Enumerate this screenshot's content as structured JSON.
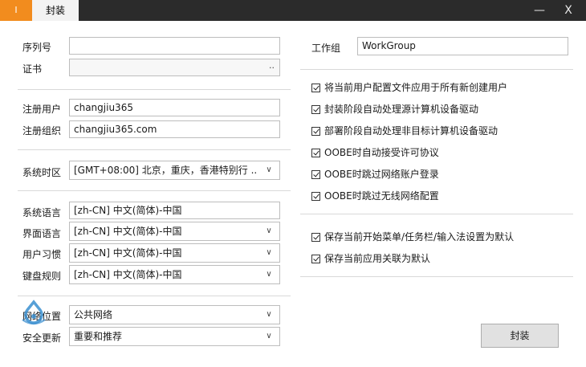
{
  "window": {
    "app_badge": "I",
    "tab_title": "封装",
    "minimize_glyph": "—",
    "close_glyph": "X"
  },
  "left": {
    "serial_label": "序列号",
    "serial_value": "",
    "cert_label": "证书",
    "cert_value": "",
    "cert_browse": "..",
    "reg_user_label": "注册用户",
    "reg_user_value": "changjiu365",
    "reg_org_label": "注册组织",
    "reg_org_value": "changjiu365.com",
    "timezone_label": "系统时区",
    "timezone_value": "[GMT+08:00] 北京，重庆，香港特别行 ..",
    "sys_lang_label": "系统语言",
    "sys_lang_value": "[zh-CN] 中文(简体)-中国",
    "ui_lang_label": "界面语言",
    "ui_lang_value": "[zh-CN] 中文(简体)-中国",
    "user_locale_label": "用户习惯",
    "user_locale_value": "[zh-CN] 中文(简体)-中国",
    "keyboard_label": "键盘规则",
    "keyboard_value": "[zh-CN] 中文(简体)-中国",
    "network_label": "网络位置",
    "network_value": "公共网络",
    "update_label": "安全更新",
    "update_value": "重要和推荐"
  },
  "right": {
    "workgroup_label": "工作组",
    "workgroup_value": "WorkGroup",
    "options": [
      "将当前用户配置文件应用于所有新创建用户",
      "封装阶段自动处理源计算机设备驱动",
      "部署阶段自动处理非目标计算机设备驱动",
      "OOBE时自动接受许可协议",
      "OOBE时跳过网络账户登录",
      "OOBE时跳过无线网络配置"
    ],
    "options2": [
      "保存当前开始菜单/任务栏/输入法设置为默认",
      "保存当前应用关联为默认"
    ],
    "package_button": "封装"
  },
  "colors": {
    "titlebar": "#2b2b2b",
    "accent": "#f28c1e",
    "watermark": "#3a8fd0"
  }
}
